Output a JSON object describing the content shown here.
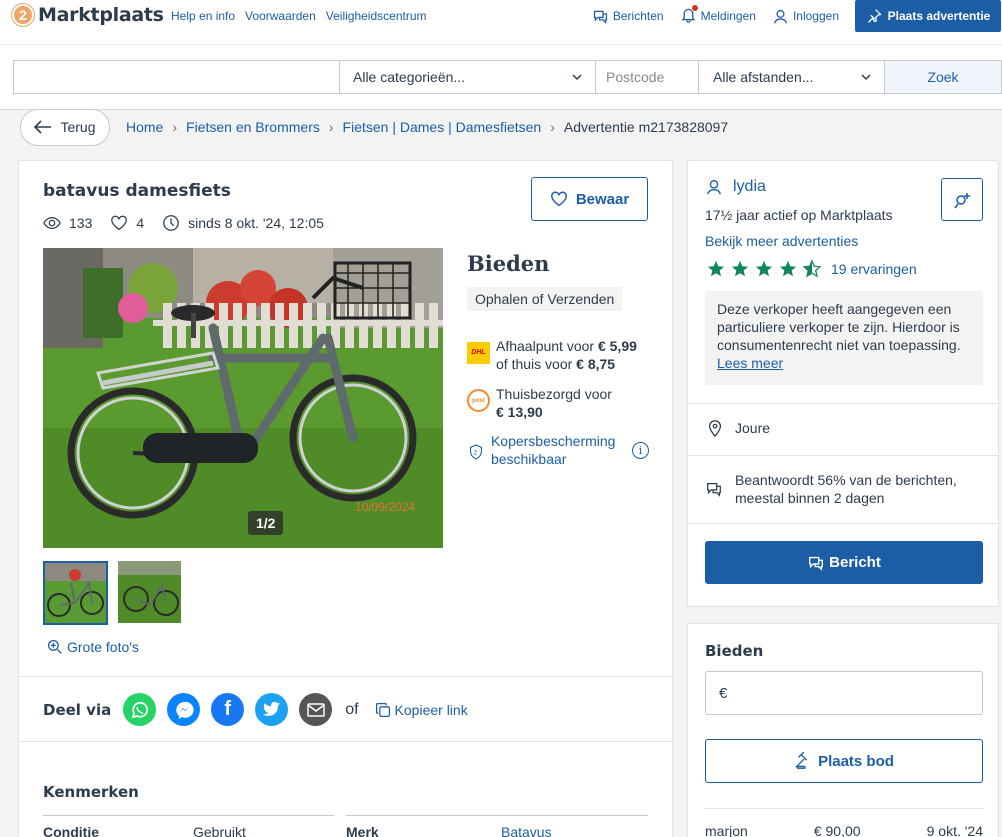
{
  "header": {
    "logo": "Marktplaats",
    "links": [
      "Help en info",
      "Voorwaarden",
      "Veiligheidscentrum"
    ],
    "messages": "Berichten",
    "notifications": "Meldingen",
    "login": "Inloggen",
    "place_ad": "Plaats advertentie"
  },
  "search": {
    "query": "",
    "category": "Alle categorieën...",
    "postcode_placeholder": "Postcode",
    "distance": "Alle afstanden...",
    "button": "Zoek"
  },
  "breadcrumb": {
    "back": "Terug",
    "items": [
      "Home",
      "Fietsen en Brommers",
      "Fietsen | Dames | Damesfietsen"
    ],
    "current": "Advertentie m2173828097"
  },
  "listing": {
    "title": "batavus damesfiets",
    "views": "133",
    "favorites": "4",
    "since": "sinds 8 okt. '24, 12:05",
    "save": "Bewaar",
    "photo_counter": "1/2",
    "photo_date_stamp": "10/09/2024",
    "big_photos": "Grote foto's",
    "price": "Bieden",
    "delivery": "Ophalen of Verzenden",
    "dhl_line1_pre": "Afhaalpunt voor",
    "dhl_line1_price": "€ 5,99",
    "dhl_line2_pre": "of thuis voor",
    "dhl_line2_price": "€ 8,75",
    "postnl_line1": "Thuisbezorgd voor",
    "postnl_price": "€ 13,90",
    "buyer_protection": "Kopersbescherming beschikbaar",
    "share_label": "Deel via",
    "of": "of",
    "copy_link": "Kopieer link",
    "features_title": "Kenmerken",
    "features": [
      {
        "key": "Conditie",
        "value": "Gebruikt"
      },
      {
        "key": "Merk",
        "value": "Batavus"
      }
    ]
  },
  "seller": {
    "name": "lydia",
    "years": "17½ jaar actief op Marktplaats",
    "more_ads": "Bekijk meer advertenties",
    "rating": 4.5,
    "reviews": "19 ervaringen",
    "notice": "Deze verkoper heeft aangegeven een particuliere verkoper te zijn. Hierdoor is consumentenrecht niet van toepassing.",
    "read_more": "Lees meer",
    "location": "Joure",
    "response_line1": "Beantwoordt 56% van de berichten,",
    "response_line2": "meestal binnen 2 dagen",
    "message_button": "Bericht"
  },
  "bidding": {
    "title": "Bieden",
    "currency": "€",
    "button": "Plaats bod",
    "bids": [
      {
        "name": "marjon",
        "amount": "€ 90,00",
        "date": "9 okt. '24"
      }
    ]
  },
  "colors": {
    "brand_blue": "#1c5ea6",
    "logo_orange": "#eda566",
    "star_green": "#14855f"
  }
}
